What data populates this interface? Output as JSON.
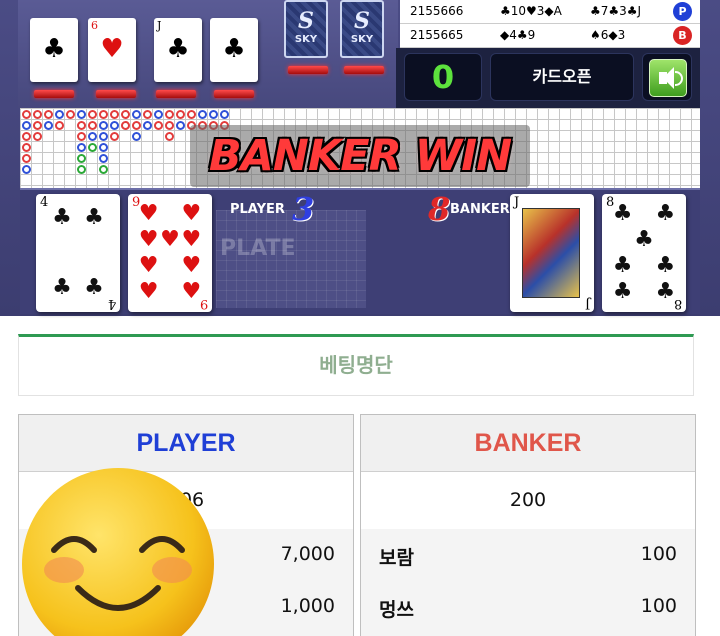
{
  "top_cards": [
    {
      "rank": "",
      "suit": "♣",
      "color": "#111"
    },
    {
      "rank": "6",
      "suit": "♥",
      "color": "#d11"
    },
    {
      "rank": "J",
      "suit": "♣",
      "color": "#111"
    },
    {
      "rank": "",
      "suit": "♣",
      "color": "#111"
    }
  ],
  "deck_backs": [
    {
      "text": "SKY",
      "num": "S"
    },
    {
      "text": "SKY",
      "num": "S"
    }
  ],
  "history": [
    {
      "id": "2155666",
      "player": "♣10♥3◆A",
      "banker": "♣7♣3♣J",
      "badge": "P",
      "badge_color": "#1f3fd6"
    },
    {
      "id": "2155665",
      "player": "◆4♣9",
      "banker": "♠6◆3",
      "badge": "B",
      "badge_color": "#d92424"
    }
  ],
  "controls": {
    "count": "0",
    "open_label": "카드오픈"
  },
  "banner": "BANKER WIN",
  "table": {
    "player_label": "PLAYER",
    "player_score": "3",
    "banker_label": "BANKER",
    "banker_score": "8",
    "watermark": "PLATE"
  },
  "player_cards": [
    {
      "rank": "4",
      "suit": "♣",
      "color": "#111",
      "pips": [
        "♣",
        "♣",
        "♣",
        "♣"
      ]
    },
    {
      "rank": "9",
      "suit": "♥",
      "color": "#d11",
      "pips": [
        "♥",
        "♥",
        "♥",
        "♥",
        "♥",
        "♥",
        "♥",
        "♥",
        "♥"
      ]
    }
  ],
  "banker_cards": [
    {
      "rank": "J",
      "suit": "♠",
      "color": "#111",
      "face": true
    },
    {
      "rank": "8",
      "suit": "♣",
      "color": "#111",
      "pips": [
        "♣",
        "♣",
        "♣",
        "♣",
        "♣",
        "♣",
        "♣",
        "♣"
      ]
    }
  ],
  "bet_title": "베팅명단",
  "player_col": {
    "header": "PLAYER",
    "header_color": "#1f3fd6",
    "total": "406",
    "rows": [
      {
        "name": "",
        "amount": "7,000"
      },
      {
        "name": "",
        "amount": "1,000"
      }
    ]
  },
  "banker_col": {
    "header": "BANKER",
    "header_color": "#e0564a",
    "total": "200",
    "rows": [
      {
        "name": "보람",
        "amount": "100"
      },
      {
        "name": "멍쓰",
        "amount": "100"
      }
    ]
  },
  "sticker": "smiley-emoji"
}
